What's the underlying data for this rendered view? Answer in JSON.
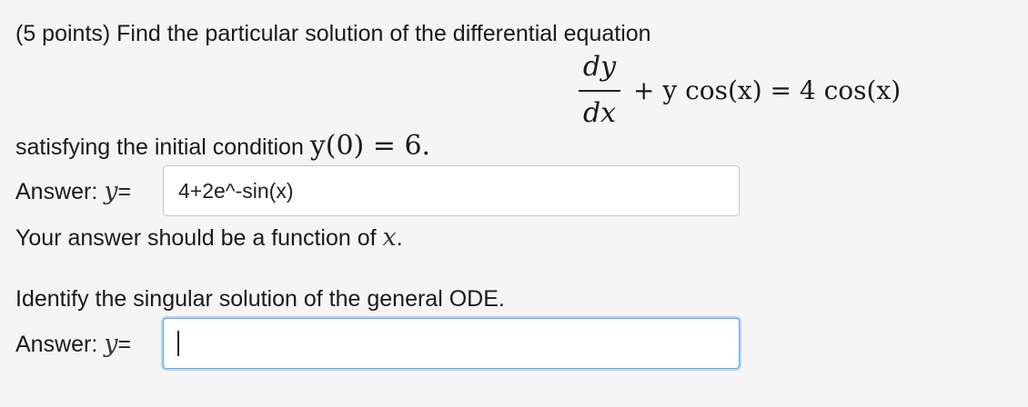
{
  "question": {
    "intro": "(5 points) Find the particular solution of the differential equation",
    "equation": {
      "numerator": "dy",
      "denominator": "dx",
      "rest": "+ y cos(x) = 4 cos(x)"
    },
    "condition_prefix": "satisfying the initial condition",
    "condition_math": "y(0) = 6.",
    "answer1": {
      "label": "Answer:",
      "var": "y",
      "eq": "=",
      "value": "4+2e^-sin(x)"
    },
    "hint_prefix": "Your answer should be a function of",
    "hint_var": "x",
    "hint_suffix": ".",
    "part2": {
      "prompt": "Identify the singular solution of the general ODE.",
      "label": "Answer:",
      "var": "y",
      "eq": "=",
      "value": ""
    }
  }
}
